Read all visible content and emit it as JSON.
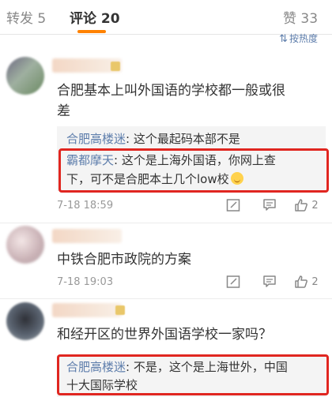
{
  "tabs": {
    "repost": "转发 5",
    "comments": "评论 20",
    "likes": "赞 33"
  },
  "sort": {
    "label": "按热度",
    "icon": "sort-icon"
  },
  "comments": [
    {
      "text_line1": "合肥基本上叫外国语的学校都一般或很",
      "text_line2": "差",
      "replies": [
        {
          "user": "合肥高楼迷",
          "sep": ":",
          "text": " 这个最起码本部不是"
        },
        {
          "user": "霸都摩天",
          "sep": ":",
          "text": " 这个是上海外国语，你网上查",
          "line2": "下，可不是合肥本土几个low校"
        }
      ],
      "time": "7-18 18:59",
      "likes": "2"
    },
    {
      "text_line1": "中铁合肥市政院的方案",
      "time": "7-18 19:03",
      "likes": "2"
    },
    {
      "text_line1": "和经开区的世界外国语学校一家吗？",
      "replies": [
        {
          "user": "合肥高楼迷",
          "sep": ":",
          "text": " 不是，这个是上海世外，中国",
          "line2": "十大国际学校"
        }
      ]
    }
  ],
  "colors": {
    "accent": "#ff8200",
    "link": "#5d7dab",
    "highlight": "#e02620"
  }
}
